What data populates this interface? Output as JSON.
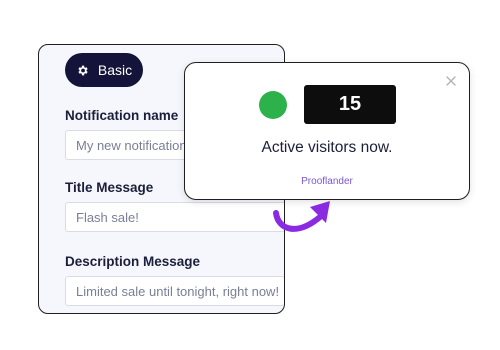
{
  "form": {
    "badge_label": "Basic",
    "badge_icon": "gear-icon",
    "fields": [
      {
        "label": "Notification name",
        "value": "My new notification"
      },
      {
        "label": "Title Message",
        "value": "Flash sale!"
      },
      {
        "label": "Description Message",
        "value": "Limited sale until tonight, right now!"
      }
    ]
  },
  "popup": {
    "count": "15",
    "message": "Active visitors now.",
    "brand": "Prooflander",
    "status_color": "#2db14b",
    "close_icon": "close-icon"
  },
  "colors": {
    "badge_bg": "#14143a",
    "arrow": "#8a2be2",
    "brand": "#7a56d6"
  }
}
